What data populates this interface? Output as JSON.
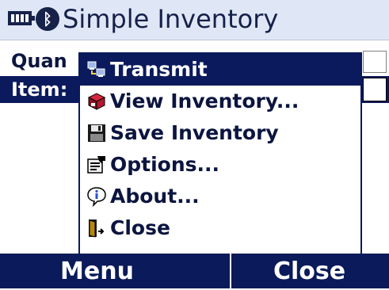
{
  "title_bar": {
    "battery_icon": "battery-icon",
    "bluetooth_icon": "bluetooth-icon",
    "bluetooth_glyph": "ᛒ",
    "app_title": "Simple Inventory"
  },
  "form": {
    "quantity_label": "Quan",
    "item_label": "Item:"
  },
  "menu": {
    "items": [
      {
        "label": "Transmit",
        "icon": "transmit-icon"
      },
      {
        "label": "View Inventory...",
        "icon": "view-inventory-icon"
      },
      {
        "label": "Save Inventory",
        "icon": "floppy-disk-icon"
      },
      {
        "label": "Options...",
        "icon": "options-icon"
      },
      {
        "label": "About...",
        "icon": "about-info-icon"
      },
      {
        "label": "Close",
        "icon": "close-door-icon"
      }
    ]
  },
  "softkeys": {
    "left": "Menu",
    "right": "Close"
  },
  "colors": {
    "accent": "#0b1a5c",
    "title_bar_bg": "#dfe7f6",
    "text": "#0b153f"
  }
}
